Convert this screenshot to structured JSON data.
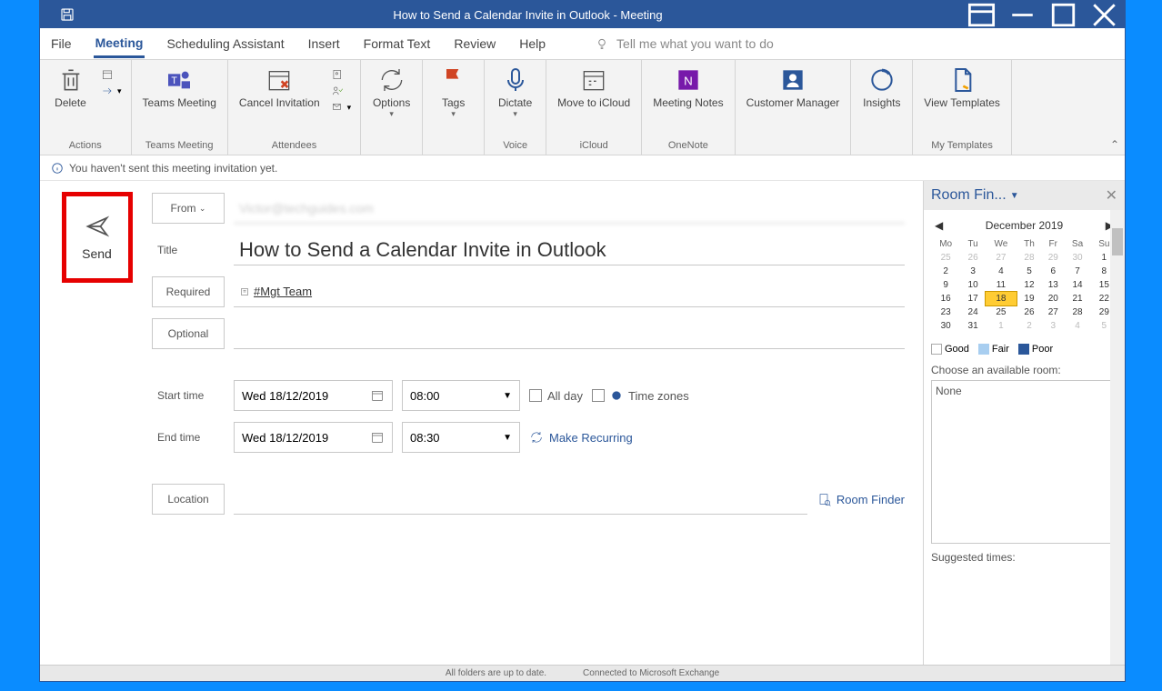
{
  "titlebar": {
    "title": "How to Send a Calendar Invite in Outlook  -  Meeting"
  },
  "tabs": {
    "file": "File",
    "meeting": "Meeting",
    "scheduling": "Scheduling Assistant",
    "insert": "Insert",
    "format": "Format Text",
    "review": "Review",
    "help": "Help",
    "tell": "Tell me what you want to do"
  },
  "ribbon": {
    "delete": "Delete",
    "teams": "Teams Meeting",
    "cancel": "Cancel Invitation",
    "options": "Options",
    "tags": "Tags",
    "dictate": "Dictate",
    "icloud": "Move to iCloud",
    "notes": "Meeting Notes",
    "custmgr": "Customer Manager",
    "insights": "Insights",
    "templates": "View Templates",
    "groups": {
      "actions": "Actions",
      "teams": "Teams Meeting",
      "attendees": "Attendees",
      "voice": "Voice",
      "icloud": "iCloud",
      "onenote": "OneNote",
      "mytemplates": "My Templates"
    }
  },
  "infobar": "You haven't sent this meeting invitation yet.",
  "send": "Send",
  "fields": {
    "from": "From",
    "title": "Title",
    "required": "Required",
    "optional": "Optional",
    "start": "Start time",
    "end": "End time",
    "location": "Location",
    "title_value": "How to Send a Calendar Invite in Outlook",
    "required_value": "#Mgt Team",
    "start_date": "Wed 18/12/2019",
    "start_time": "08:00",
    "end_date": "Wed 18/12/2019",
    "end_time": "08:30",
    "allday": "All day",
    "timezones": "Time zones",
    "recurring": "Make Recurring",
    "roomfinder": "Room Finder"
  },
  "pane": {
    "title": "Room Fin...",
    "month": "December 2019",
    "days": [
      "Mo",
      "Tu",
      "We",
      "Th",
      "Fr",
      "Sa",
      "Su"
    ],
    "weeks": [
      [
        {
          "d": "25",
          "o": true
        },
        {
          "d": "26",
          "o": true
        },
        {
          "d": "27",
          "o": true
        },
        {
          "d": "28",
          "o": true
        },
        {
          "d": "29",
          "o": true
        },
        {
          "d": "30",
          "o": true
        },
        {
          "d": "1"
        }
      ],
      [
        {
          "d": "2"
        },
        {
          "d": "3"
        },
        {
          "d": "4"
        },
        {
          "d": "5"
        },
        {
          "d": "6"
        },
        {
          "d": "7"
        },
        {
          "d": "8"
        }
      ],
      [
        {
          "d": "9"
        },
        {
          "d": "10"
        },
        {
          "d": "11"
        },
        {
          "d": "12"
        },
        {
          "d": "13"
        },
        {
          "d": "14"
        },
        {
          "d": "15"
        }
      ],
      [
        {
          "d": "16"
        },
        {
          "d": "17"
        },
        {
          "d": "18",
          "s": true
        },
        {
          "d": "19"
        },
        {
          "d": "20"
        },
        {
          "d": "21"
        },
        {
          "d": "22"
        }
      ],
      [
        {
          "d": "23"
        },
        {
          "d": "24"
        },
        {
          "d": "25"
        },
        {
          "d": "26"
        },
        {
          "d": "27"
        },
        {
          "d": "28"
        },
        {
          "d": "29"
        }
      ],
      [
        {
          "d": "30"
        },
        {
          "d": "31"
        },
        {
          "d": "1",
          "o": true
        },
        {
          "d": "2",
          "o": true
        },
        {
          "d": "3",
          "o": true
        },
        {
          "d": "4",
          "o": true
        },
        {
          "d": "5",
          "o": true
        }
      ]
    ],
    "legend": {
      "good": "Good",
      "fair": "Fair",
      "poor": "Poor"
    },
    "choose": "Choose an available room:",
    "rooms": "None",
    "suggest": "Suggested times:"
  },
  "status": {
    "folders": "All folders are up to date.",
    "connected": "Connected to Microsoft Exchange"
  }
}
